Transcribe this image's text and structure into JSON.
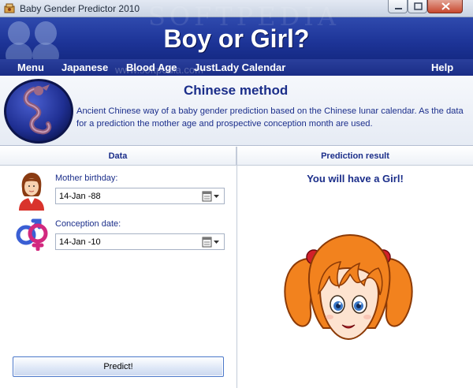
{
  "window": {
    "title": "Baby Gender Predictor 2010",
    "watermark": "SOFTPEDIA",
    "watermark_small": "www.softpedia.com"
  },
  "header": {
    "title": "Boy or Girl?"
  },
  "menu": {
    "items": [
      "Menu",
      "Japanese",
      "Blood Age",
      "JustLady Calendar"
    ],
    "help": "Help"
  },
  "method": {
    "title": "Chinese method",
    "description": "Ancient Chinese way of a baby gender prediction based on the Chinese lunar calendar. As the data for a prediction the mother age and prospective conception month are used."
  },
  "data_panel": {
    "header": "Data",
    "mother_birthday_label": "Mother birthday:",
    "mother_birthday_value": "14-Jan -88",
    "conception_label": "Conception date:",
    "conception_value": "14-Jan -10",
    "predict_button": "Predict!"
  },
  "result_panel": {
    "header": "Prediction result",
    "result_text": "You will have a Girl!"
  },
  "colors": {
    "banner": "#1d3497",
    "text_accent": "#1b2e8a",
    "close_button": "#c8482f",
    "girl_hair": "#f2821e"
  },
  "icons": {
    "app": "baby-icon",
    "medallion": "dragon-medallion-icon",
    "mother": "mother-avatar-icon",
    "gender": "gender-symbols-icon",
    "calendar": "calendar-dropdown-icon",
    "result_image": "girl-face-image"
  }
}
